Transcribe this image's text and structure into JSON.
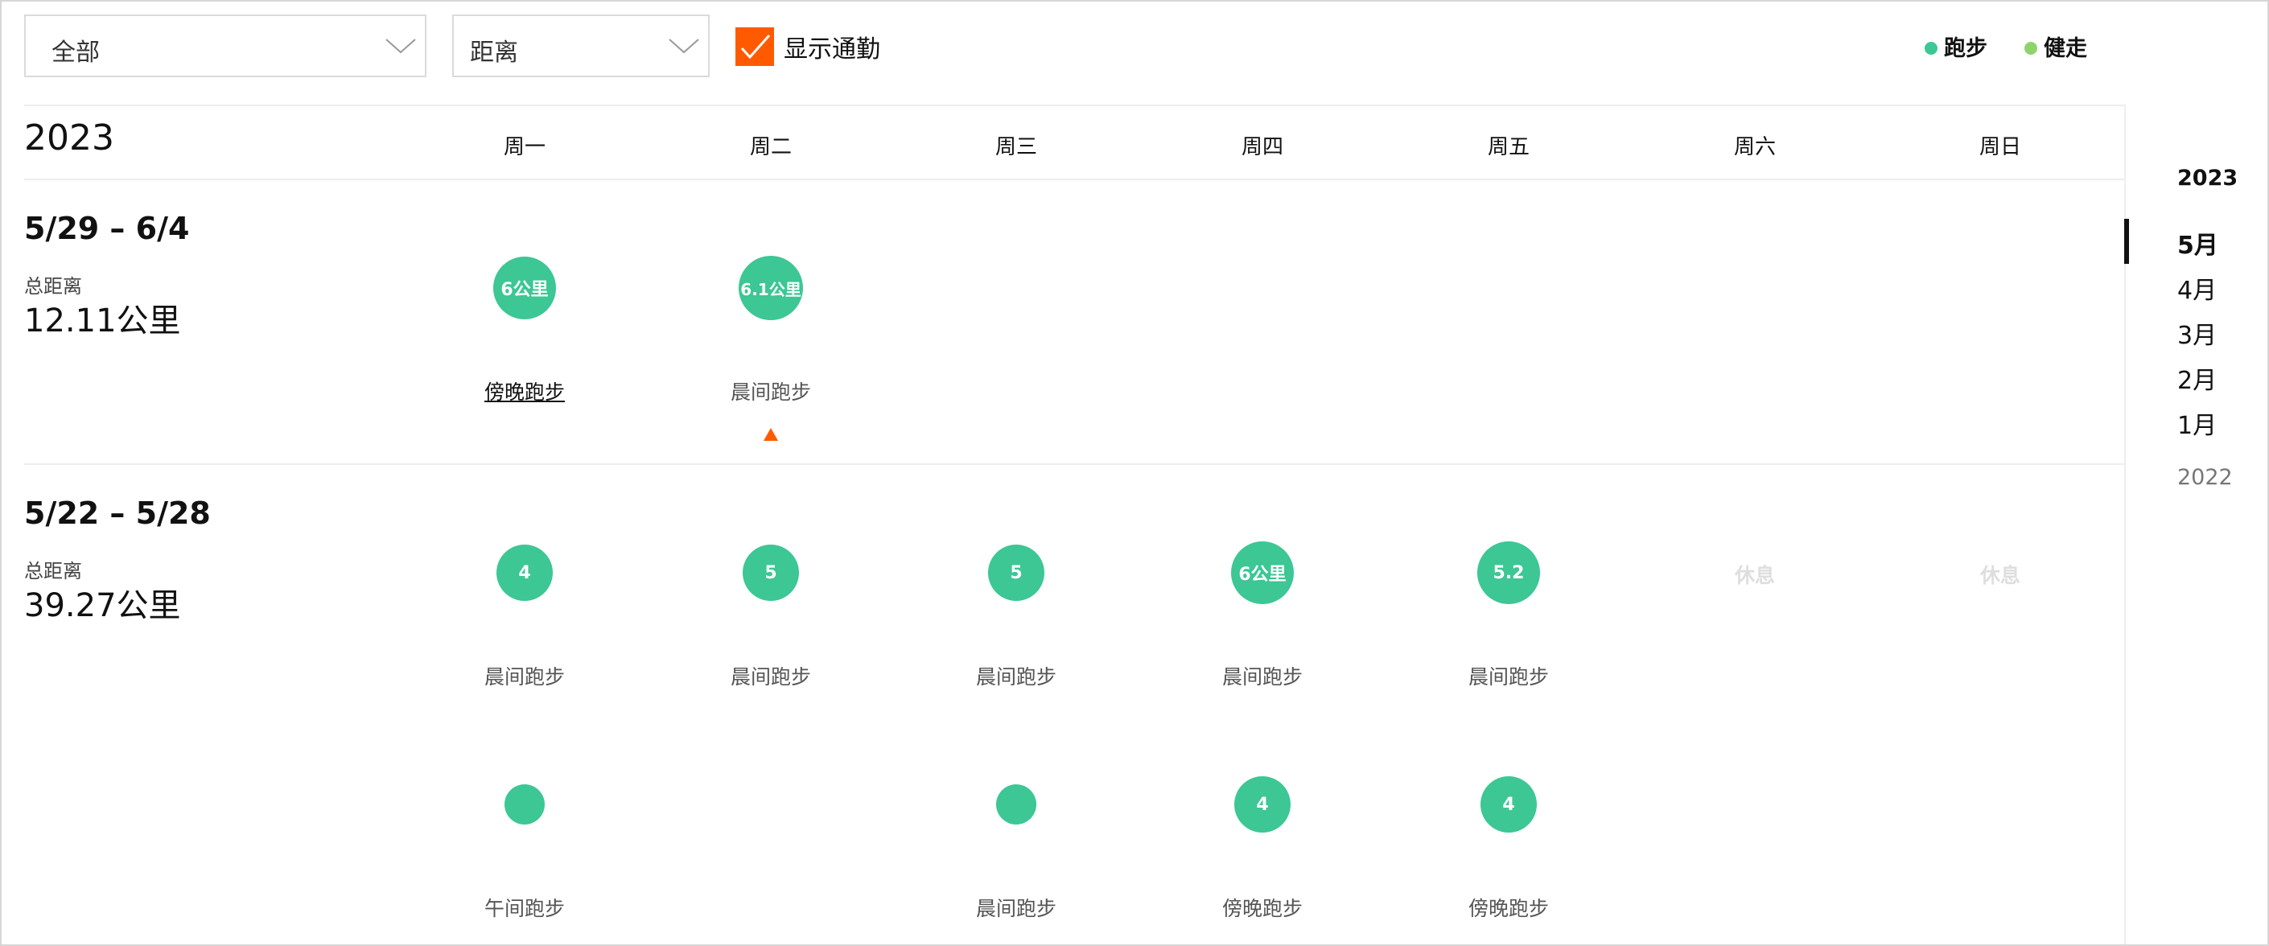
{
  "toolbar": {
    "filter_sport": "全部",
    "filter_metric": "距离",
    "commute_label": "显示通勤",
    "commute_checked": true,
    "legend": [
      {
        "label": "跑步",
        "color": "#3cc795"
      },
      {
        "label": "健走",
        "color": "#8fd46a"
      }
    ]
  },
  "calendar": {
    "year": "2023",
    "days": [
      "周一",
      "周二",
      "周三",
      "周四",
      "周五",
      "周六",
      "周日"
    ],
    "sum_label": "总距离",
    "rest_label": "休息",
    "weeks": [
      {
        "range": "5/29 – 6/4",
        "total": "12.11公里",
        "rows": [
          [
            {
              "day": 0,
              "value": "6公里",
              "label": "傍晚跑步",
              "link": true
            },
            {
              "day": 1,
              "value": "6.1公里",
              "label": "晨间跑步",
              "marker": true
            }
          ]
        ]
      },
      {
        "range": "5/22 – 5/28",
        "total": "39.27公里",
        "rows": [
          [
            {
              "day": 0,
              "value": "4",
              "label": "晨间跑步"
            },
            {
              "day": 1,
              "value": "5",
              "label": "晨间跑步"
            },
            {
              "day": 2,
              "value": "5",
              "label": "晨间跑步"
            },
            {
              "day": 3,
              "value": "6公里",
              "label": "晨间跑步"
            },
            {
              "day": 4,
              "value": "5.2",
              "label": "晨间跑步"
            },
            {
              "day": 5,
              "rest": true
            },
            {
              "day": 6,
              "rest": true
            }
          ],
          [
            {
              "day": 0,
              "value": "",
              "label": "午间跑步"
            },
            {
              "day": 2,
              "value": "",
              "label": "晨间跑步"
            },
            {
              "day": 3,
              "value": "4",
              "label": "傍晚跑步"
            },
            {
              "day": 4,
              "value": "4",
              "label": "傍晚跑步"
            }
          ]
        ]
      }
    ]
  },
  "sidebar": {
    "year": "2023",
    "months": [
      "5月",
      "4月",
      "3月",
      "2月",
      "1月"
    ],
    "active_index": 0,
    "prev_year": "2022"
  }
}
